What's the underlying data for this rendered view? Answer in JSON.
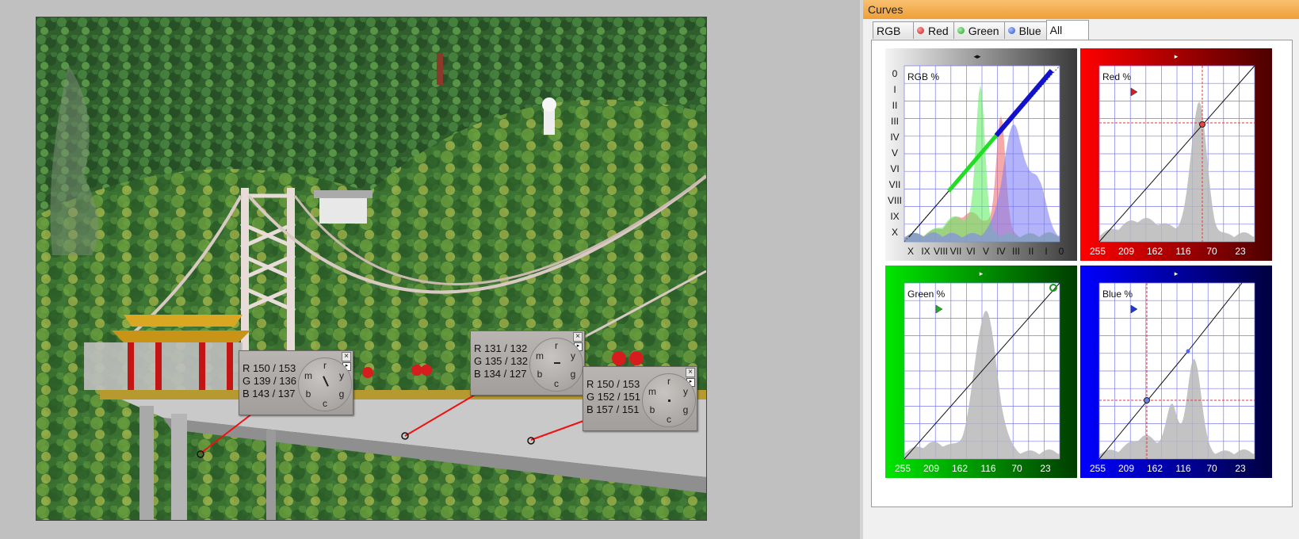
{
  "window": {
    "title": "Curves"
  },
  "tabs": [
    {
      "label": "RGB",
      "icon": "none",
      "active": false
    },
    {
      "label": "Red",
      "icon": "red-dot-icon",
      "color": "#d43a3a",
      "active": false
    },
    {
      "label": "Green",
      "icon": "green-dot-icon",
      "color": "#3bb43b",
      "active": false
    },
    {
      "label": "Blue",
      "icon": "blue-dot-icon",
      "color": "#2f61d4",
      "active": false
    },
    {
      "label": "All",
      "icon": "none",
      "active": true
    }
  ],
  "probes": [
    {
      "r": "R 150 / 153",
      "g": "G 139 / 136",
      "b": "B 143 / 137"
    },
    {
      "r": "R 131 / 132",
      "g": "G 135 / 132",
      "b": "B 134 / 127"
    },
    {
      "r": "R 150 / 153",
      "g": "G 152 / 151",
      "b": "B 157 / 151"
    }
  ],
  "wheel_labels": [
    "r",
    "y",
    "g",
    "c",
    "b",
    "m"
  ],
  "panels": {
    "rgb": {
      "label": "RGB %",
      "zone_labels": [
        "0",
        "I",
        "II",
        "III",
        "IV",
        "V",
        "VI",
        "VII",
        "VIII",
        "IX",
        "X"
      ],
      "bottom_labels": [
        "X",
        "IX",
        "VIII",
        "VII",
        "VI",
        "V",
        "IV",
        "III",
        "II",
        "I",
        "0"
      ]
    },
    "red": {
      "label": "Red %",
      "bottom_labels": [
        "255",
        "209",
        "162",
        "116",
        "70",
        "23"
      ]
    },
    "green": {
      "label": "Green %",
      "bottom_labels": [
        "255",
        "209",
        "162",
        "116",
        "70",
        "23"
      ]
    },
    "blue": {
      "label": "Blue %",
      "bottom_labels": [
        "255",
        "209",
        "162",
        "116",
        "70",
        "23"
      ]
    }
  },
  "colors": {
    "red_panel": "#a50000",
    "green_panel": "#0a8c0a",
    "blue_panel": "#000098",
    "rgb_panel": "#555555"
  }
}
